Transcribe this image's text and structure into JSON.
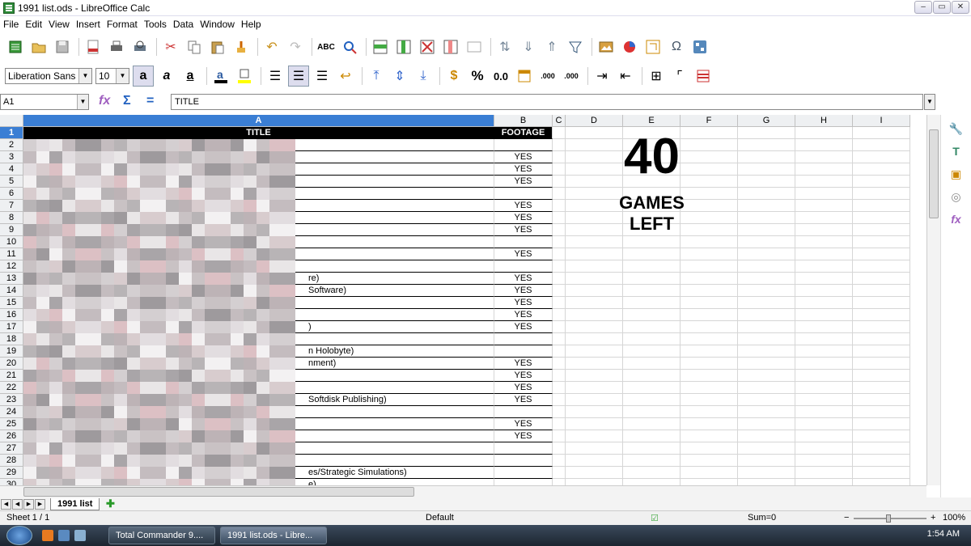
{
  "window": {
    "title": "1991 list.ods - LibreOffice Calc",
    "btn_min": "‒",
    "btn_max": "▭",
    "btn_close": "✕"
  },
  "menu": [
    "File",
    "Edit",
    "View",
    "Insert",
    "Format",
    "Tools",
    "Data",
    "Window",
    "Help"
  ],
  "toolbar2": {
    "font_name": "Liberation Sans",
    "font_size": "10",
    "percent": "%",
    "decimal": "0.0",
    "add_decimal": ".000",
    "del_decimal": ".000"
  },
  "formula": {
    "cell_ref": "A1",
    "content": "TITLE"
  },
  "columns": [
    "A",
    "B",
    "C",
    "D",
    "E",
    "F",
    "G",
    "H",
    "I"
  ],
  "rows": [
    "1",
    "2",
    "3",
    "4",
    "5",
    "6",
    "7",
    "8",
    "9",
    "10",
    "11",
    "12",
    "13",
    "14",
    "15",
    "16",
    "17",
    "18",
    "19",
    "20",
    "21",
    "22",
    "23",
    "24",
    "25",
    "26",
    "27",
    "28",
    "29",
    "30"
  ],
  "cells": {
    "A1": "TITLE",
    "B1": "FOOTAGE",
    "A13": "re)",
    "A14": "Software)",
    "A17": ")",
    "A19": "n Holobyte)",
    "A20": "nment)",
    "A23": "Softdisk Publishing)",
    "A29": "es/Strategic Simulations)",
    "A30": "e)",
    "yes_label": "YES"
  },
  "yes_rows": [
    3,
    4,
    5,
    7,
    8,
    9,
    11,
    13,
    14,
    15,
    16,
    17,
    20,
    21,
    22,
    23,
    25,
    26
  ],
  "counter": {
    "number": "40",
    "line1": "GAMES",
    "line2": "LEFT"
  },
  "sheet_tab": "1991 list",
  "status": {
    "sheet": "Sheet 1 / 1",
    "style": "Default",
    "sum": "Sum=0",
    "zoom": "100%"
  },
  "taskbar": {
    "items": [
      "Total Commander 9....",
      "1991 list.ods - Libre..."
    ],
    "clock": "1:54 AM"
  }
}
